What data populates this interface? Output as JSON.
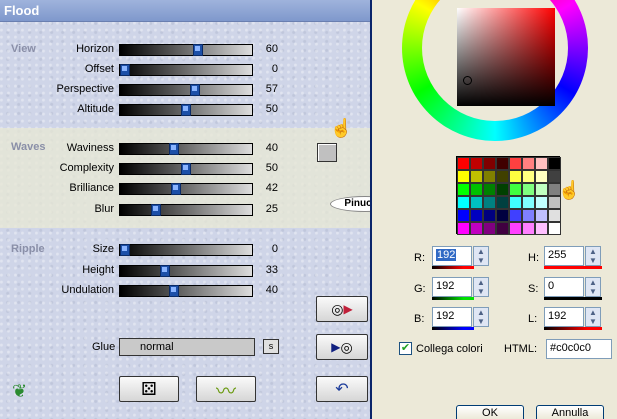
{
  "flood": {
    "title": "Flood",
    "groups": {
      "view": "View",
      "waves": "Waves",
      "ripple": "Ripple"
    },
    "sliders": [
      {
        "label": "Horizon",
        "value": "60",
        "level": 0.6
      },
      {
        "label": "Offset",
        "value": "0",
        "level": 0.0
      },
      {
        "label": "Perspective",
        "value": "57",
        "level": 0.57
      },
      {
        "label": "Altitude",
        "value": "50",
        "level": 0.5
      },
      {
        "label": "Waviness",
        "value": "40",
        "level": 0.4
      },
      {
        "label": "Complexity",
        "value": "50",
        "level": 0.5
      },
      {
        "label": "Brilliance",
        "value": "42",
        "level": 0.42
      },
      {
        "label": "Blur",
        "value": "25",
        "level": 0.25
      },
      {
        "label": "Size",
        "value": "0",
        "level": 0.0
      },
      {
        "label": "Height",
        "value": "33",
        "level": 0.33
      },
      {
        "label": "Undulation",
        "value": "40",
        "level": 0.4
      }
    ],
    "glue_label": "Glue",
    "glue_value": "normal",
    "glue_button": "s",
    "watermark": "Pinuccia"
  },
  "picker": {
    "fields": {
      "r_label": "R:",
      "r_value": "192",
      "g_label": "G:",
      "g_value": "192",
      "b_label": "B:",
      "b_value": "192",
      "h_label": "H:",
      "h_value": "255",
      "s_label": "S:",
      "s_value": "0",
      "l_label": "L:",
      "l_value": "192"
    },
    "checkbox_label": "Collega colori",
    "html_label": "HTML:",
    "html_value": "#c0c0c0",
    "ok_label": "OK",
    "cancel_label": "Annulla",
    "current_color": "#c0c0c0",
    "palette": [
      "#ff0000",
      "#c00000",
      "#800000",
      "#400000",
      "#ff4040",
      "#ff8080",
      "#ffc0c0",
      "#000000",
      "#ffff00",
      "#c0c000",
      "#808000",
      "#404000",
      "#ffff40",
      "#ffff80",
      "#ffffc0",
      "#404040",
      "#00ff00",
      "#00c000",
      "#008000",
      "#004000",
      "#40ff40",
      "#80ff80",
      "#c0ffc0",
      "#808080",
      "#00ffff",
      "#00c0c0",
      "#008080",
      "#004040",
      "#40ffff",
      "#80ffff",
      "#c0ffff",
      "#c0c0c0",
      "#0000ff",
      "#0000c0",
      "#000080",
      "#000040",
      "#4040ff",
      "#8080ff",
      "#c0c0ff",
      "#e0e0e0",
      "#ff00ff",
      "#c000c0",
      "#800080",
      "#400040",
      "#ff40ff",
      "#ff80ff",
      "#ffc0ff",
      "#ffffff"
    ]
  }
}
